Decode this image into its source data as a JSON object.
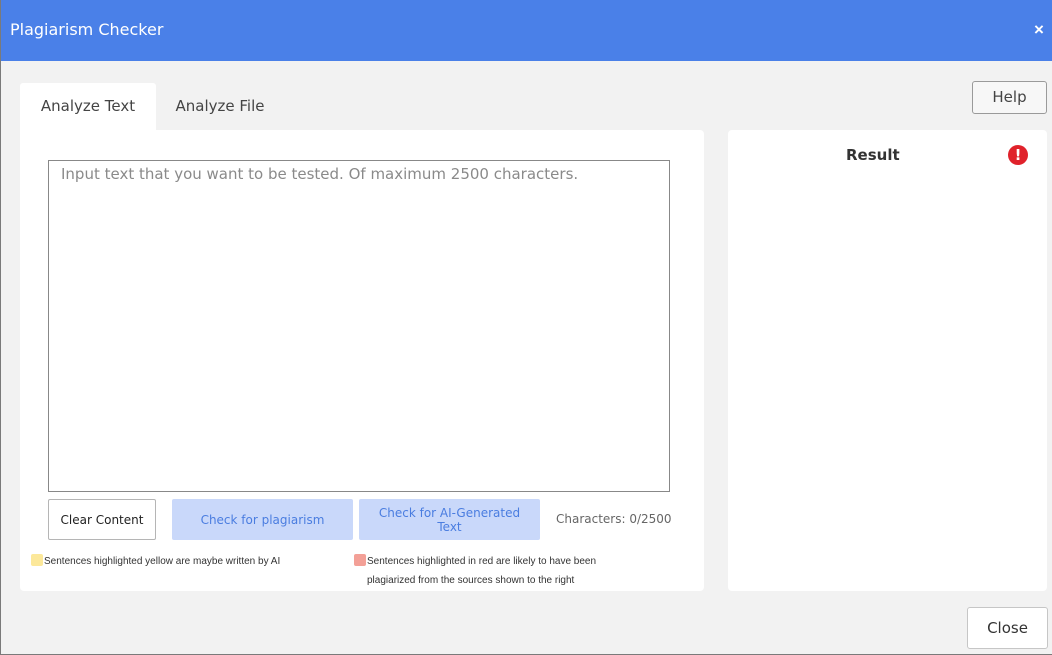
{
  "window": {
    "title": "Plagiarism Checker",
    "close_icon": "×"
  },
  "toolbar": {
    "help_label": "Help"
  },
  "tabs": [
    {
      "label": "Analyze Text",
      "active": true
    },
    {
      "label": "Analyze File",
      "active": false
    }
  ],
  "editor": {
    "placeholder": "Input text that you want to be tested. Of maximum 2500 characters.",
    "value": ""
  },
  "actions": {
    "clear_label": "Clear Content",
    "plagiarism_label": "Check for plagiarism",
    "ai_label": "Check for AI-Generated Text",
    "char_count": "Characters: 0/2500"
  },
  "legend": {
    "yellow": {
      "text": "Sentences highlighted yellow are maybe written by AI",
      "color": "#fce89a"
    },
    "red": {
      "line1": "Sentences highlighted in red are likely to have been",
      "line2": "plagiarized from the sources shown to the right",
      "color": "#f3a097"
    }
  },
  "result": {
    "title": "Result",
    "alert_icon": "!"
  },
  "footer": {
    "close_label": "Close"
  },
  "colors": {
    "titlebar": "#4a80e8",
    "button_accent_bg": "#c9d8fa",
    "button_accent_text": "#4a7de0",
    "alert": "#e0222b"
  }
}
